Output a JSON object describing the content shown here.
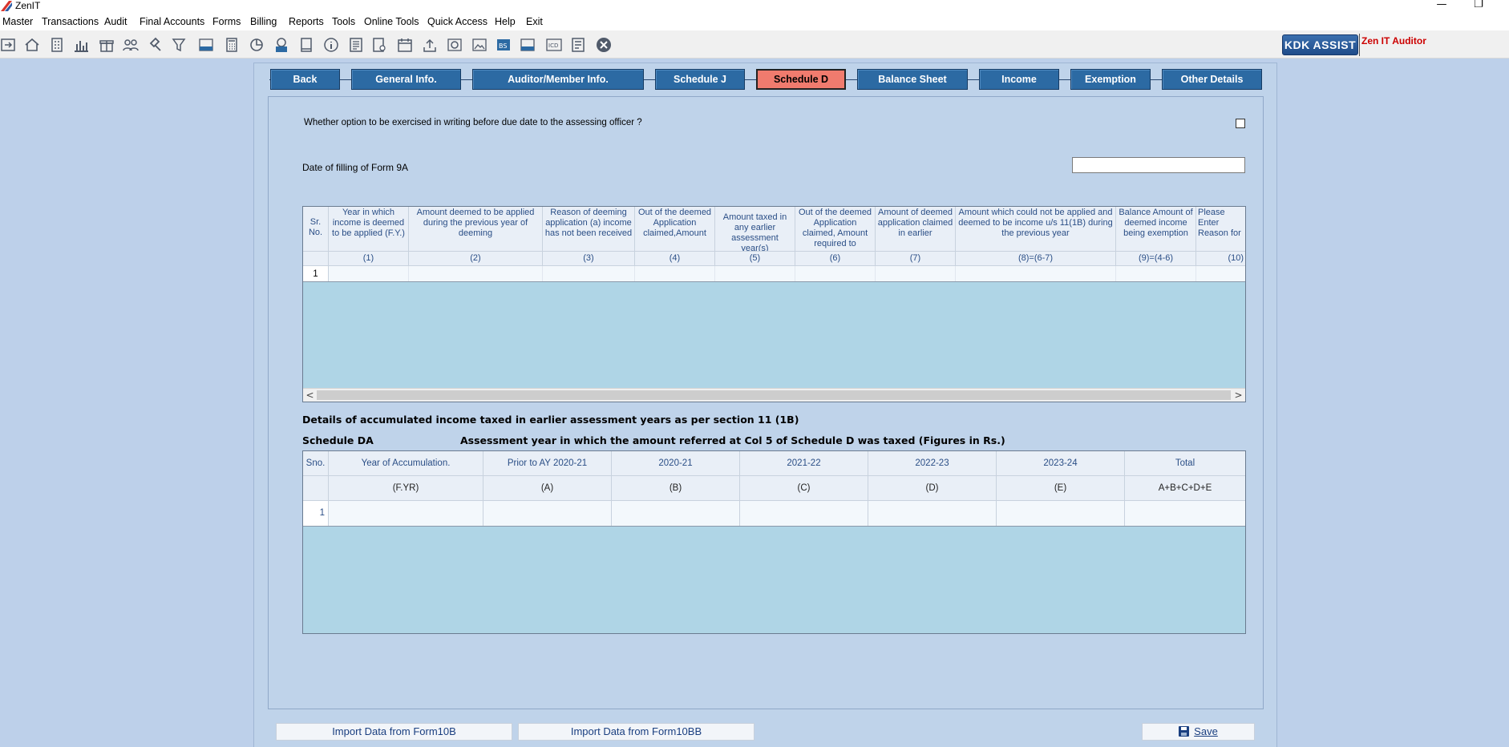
{
  "window": {
    "title": "ZenIT",
    "minimize_glyph": "—",
    "restore_glyph": "❐"
  },
  "menu": [
    "Master",
    "Transactions",
    "Audit",
    "Final Accounts",
    "Forms",
    "Billing",
    "Reports",
    "Tools",
    "Online Tools",
    "Quick Access",
    "Help",
    "Exit"
  ],
  "toolbar": {
    "icons": [
      "import-icon",
      "home-icon",
      "building-icon",
      "bar-chart-icon",
      "gift-icon",
      "users-icon",
      "gavel-icon",
      "filter-icon",
      "tax-icon",
      "calculator-icon",
      "pie-chart-icon",
      "pay-icon",
      "book-icon",
      "info-icon",
      "report-icon",
      "user-report-icon",
      "calendar-icon",
      "upload-icon",
      "refresh-icon",
      "image-icon",
      "bs-icon",
      "bs-soh-icon",
      "icd-icon",
      "form-icon",
      "close-circle-icon"
    ],
    "kdk_assist": "KDK ASSIST",
    "zen_auditor": "Zen IT Auditor"
  },
  "tabs": [
    "Back",
    "General Info.",
    "Auditor/Member Info.",
    "Schedule J",
    "Schedule D",
    "Balance Sheet",
    "Income",
    "Exemption",
    "Other Details"
  ],
  "active_tab": "Schedule D",
  "question": "Whether option to be exercised in writing before due date to the assessing officer ?",
  "date_label": "Date of filling of Form 9A",
  "date_value": "",
  "schedule_d": {
    "columns": [
      "Sr. No.",
      "Year in which income is deemed to be applied (F.Y.)",
      "Amount deemed to be applied during the previous year of deeming",
      "Reason of deeming application (a) income has not been received",
      "Out of the deemed Application claimed,Amount",
      "Amount taxed in any earlier assessment year(s)",
      "Out of the deemed Application claimed, Amount required to",
      "Amount of deemed application claimed in earlier",
      "Amount which could not be applied and deemed to be income u/s 11(1B) during the previous year",
      "Balance Amount of deemed income being exemption",
      "Please Enter Reason for"
    ],
    "subheaders": [
      "",
      "(1)",
      "(2)",
      "(3)",
      "(4)",
      "(5)",
      "(6)",
      "(7)",
      "(8)=(6-7)",
      "(9)=(4-6)",
      "(10)"
    ],
    "rows": [
      [
        "1",
        "",
        "",
        "",
        "",
        "",
        "",
        "",
        "",
        "",
        ""
      ]
    ],
    "scroll_left": "<",
    "scroll_right": ">"
  },
  "section_title": "Details of accumulated income taxed in earlier assessment years as per section 11 (1B)",
  "schedule_da": {
    "label": "Schedule DA",
    "title": "Assessment year in which the amount referred at Col 5 of Schedule D was taxed (Figures in Rs.)",
    "columns": [
      "Sno.",
      "Year of Accumulation.",
      "Prior to AY 2020-21",
      "2020-21",
      "2021-22",
      "2022-23",
      "2023-24",
      "Total"
    ],
    "subheaders": [
      "",
      "(F.YR)",
      "(A)",
      "(B)",
      "(C)",
      "(D)",
      "(E)",
      "A+B+C+D+E"
    ],
    "rows": [
      [
        "1",
        "",
        "",
        "",
        "",
        "",
        "",
        ""
      ]
    ]
  },
  "buttons": {
    "import_10b": "Import Data from Form10B",
    "import_10bb": "Import Data from Form10BB",
    "save": "Save"
  },
  "colors": {
    "tab_bg": "#2c6aa3",
    "active_tab_bg": "#f07b6e",
    "grid_empty": "#afd5e6",
    "background": "#bdd0ea"
  }
}
